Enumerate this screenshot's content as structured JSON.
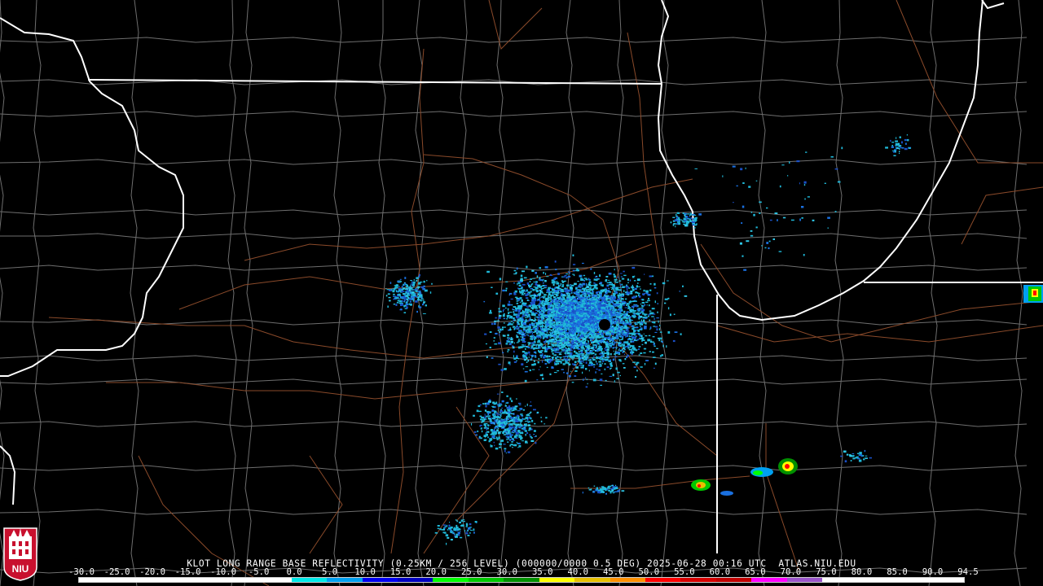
{
  "product_title": "KLOT LONG RANGE BASE REFLECTIVITY (0.25KM / 256 LEVEL) (000000/0000 0.5 DEG) 2025-06-28 00:16 UTC  ATLAS.NIU.EDU",
  "logo_text": "NIU",
  "colorbar": {
    "labels": [
      "-30.0",
      "-25.0",
      "-20.0",
      "-15.0",
      "-10.0",
      "-5.0",
      "0.0",
      "5.0",
      "10.0",
      "15.0",
      "20.0",
      "25.0",
      "30.0",
      "35.0",
      "40.0",
      "45.0",
      "50.0",
      "55.0",
      "60.0",
      "65.0",
      "70.0",
      "75.0",
      "80.0",
      "85.0",
      "90.0",
      "94.5"
    ],
    "colors": [
      "#ffffff",
      "#ffffff",
      "#ffffff",
      "#ffffff",
      "#ffffff",
      "#ffffff",
      "#00e8e8",
      "#00a0f0",
      "#0000f0",
      "#0000c0",
      "#00ff00",
      "#00c800",
      "#009000",
      "#ffff00",
      "#e7c000",
      "#ff9000",
      "#ff0000",
      "#d60000",
      "#c00000",
      "#ff00ff",
      "#9955c9",
      "#ffffff",
      "#ffffff",
      "#ffffff",
      "#ffffff"
    ]
  },
  "colors": {
    "background": "#000000",
    "county_lines": "#6e6e6e",
    "state_lines": "#ffffff",
    "roads": "#8a4a2a",
    "echo_cyan": "#1fb8d8",
    "echo_blue": "#1a70e0",
    "radar_site": "#000000"
  }
}
